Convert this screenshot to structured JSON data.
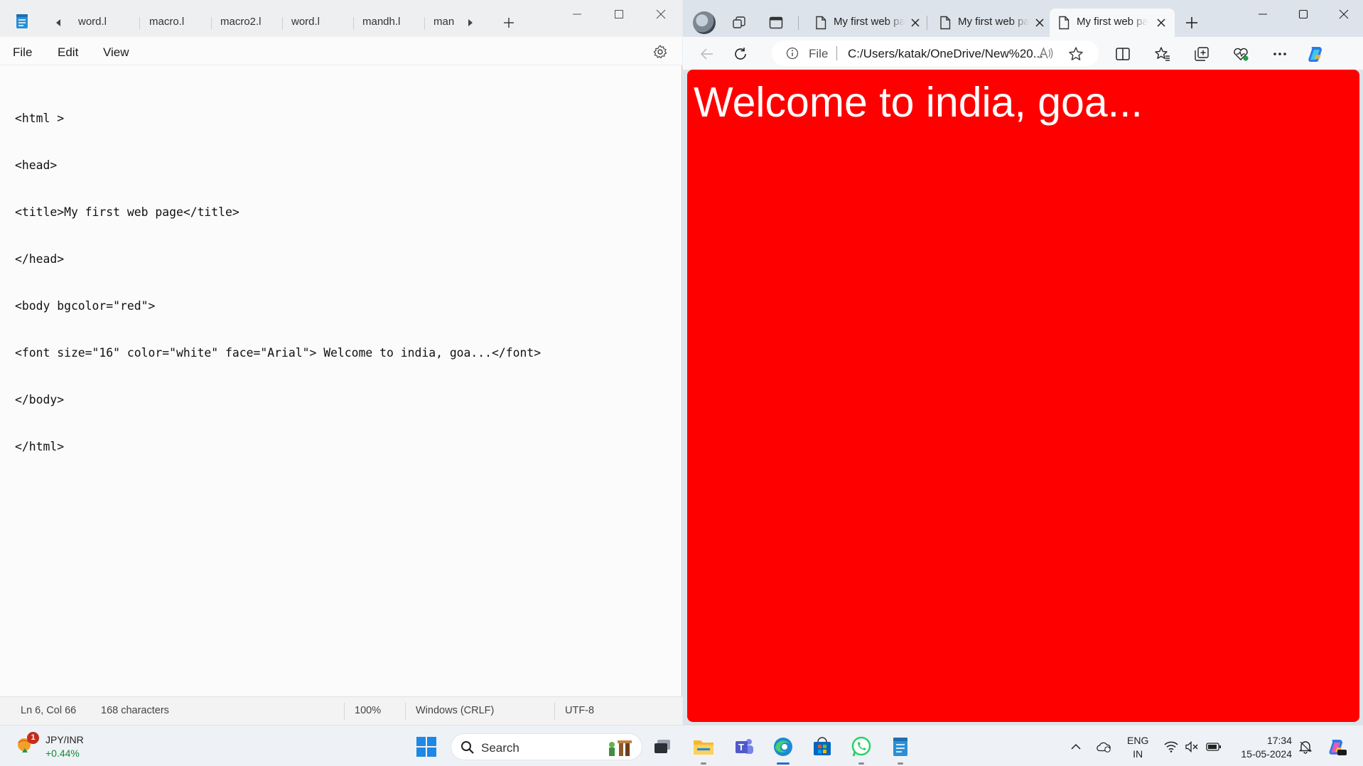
{
  "notepad": {
    "tabs": [
      "word.l",
      "macro.l",
      "macro2.l",
      "word.l",
      "mandh.l",
      "man"
    ],
    "menu": {
      "file": "File",
      "edit": "Edit",
      "view": "View"
    },
    "content_lines": [
      "<html >",
      "<head>",
      "<title>My first web page</title>",
      "</head>",
      "<body bgcolor=\"red\">",
      "<font size=\"16\" color=\"white\" face=\"Arial\"> Welcome to india, goa...</font>",
      "</body>",
      "</html>"
    ],
    "status": {
      "position": "Ln 6, Col 66",
      "characters": "168 characters",
      "zoom": "100%",
      "line_ending": "Windows (CRLF)",
      "encoding": "UTF-8"
    }
  },
  "browser": {
    "tabs": [
      {
        "title": "My first web page",
        "active": false
      },
      {
        "title": "My first web page",
        "active": false
      },
      {
        "title": "My first web page",
        "active": true
      }
    ],
    "address": {
      "scheme_label": "File",
      "url": "C:/Users/katak/OneDrive/New%20..."
    },
    "page": {
      "heading": "Welcome to india, goa...",
      "background": "#ff0000",
      "text_color": "#ffffff"
    }
  },
  "taskbar": {
    "widget": {
      "badge": "1",
      "ticker": "JPY/INR",
      "change": "+0.44%"
    },
    "search_label": "Search",
    "language": {
      "line1": "ENG",
      "line2": "IN"
    },
    "clock": {
      "time": "17:34",
      "date": "15-05-2024"
    }
  },
  "colors": {
    "accent": "#1f6fd1",
    "page_red": "#ff0000",
    "positive": "#138a36"
  }
}
